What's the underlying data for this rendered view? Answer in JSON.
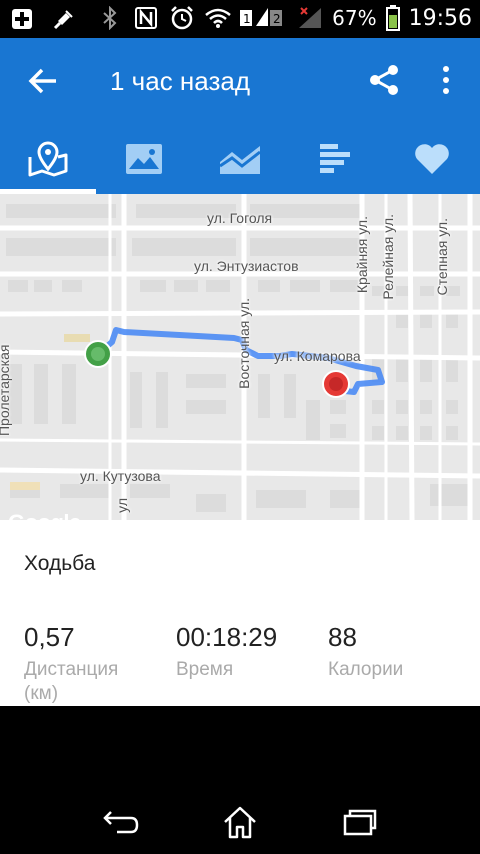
{
  "status_bar": {
    "battery_percent": "67%",
    "time": "19:56",
    "sim1": "1",
    "sim2": "2",
    "icons": [
      "add-icon",
      "mute-icon",
      "bluetooth-icon",
      "nfc-icon",
      "alarm-icon",
      "wifi-icon",
      "signal-icon",
      "battery-icon"
    ]
  },
  "app_bar": {
    "title": "1 час назад",
    "color": "#1976d2"
  },
  "tabs": [
    {
      "icon": "map-icon",
      "active": true
    },
    {
      "icon": "image-icon",
      "active": false
    },
    {
      "icon": "chart-icon",
      "active": false
    },
    {
      "icon": "bars-icon",
      "active": false
    },
    {
      "icon": "heart-icon",
      "active": false
    }
  ],
  "map": {
    "streets": {
      "gogolya": "ул. Гоголя",
      "entuziastov": "ул. Энтузиастов",
      "vostochnaya": "Восточная ул.",
      "komarova": "ул. Комарова",
      "kutuzova": "ул. Кутузова",
      "krainyaya": "Крайняя ул.",
      "releinaya": "Релейная ул.",
      "stepnaya": "Степная ул.",
      "left_cut": "Пролетарская",
      "bottom_cut": "ул"
    },
    "logo": "Google",
    "route_color": "#4285f4",
    "start_color": "#43a047",
    "end_color": "#e53935"
  },
  "workout": {
    "activity": "Ходьба",
    "stats": [
      {
        "value": "0,57",
        "label": "Дистанция",
        "unit": "(км)"
      },
      {
        "value": "00:18:29",
        "label": "Время"
      },
      {
        "value": "88",
        "label": "Калории"
      }
    ]
  }
}
